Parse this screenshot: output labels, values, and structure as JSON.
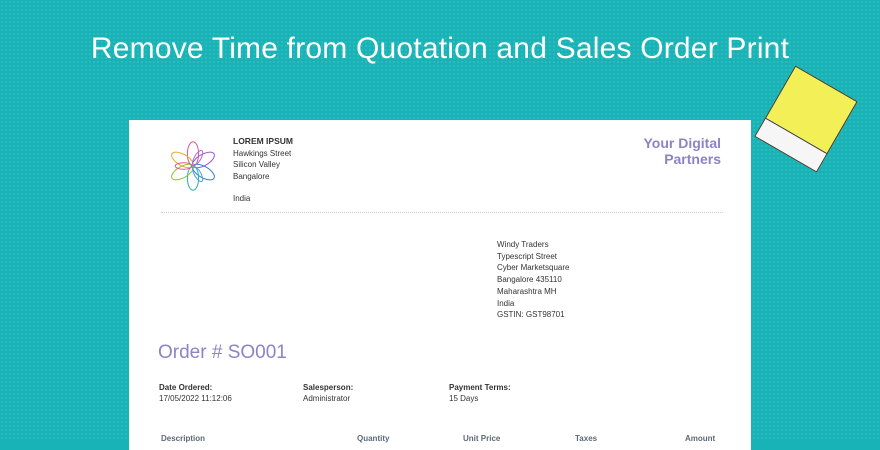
{
  "banner": {
    "title": "Remove Time from Quotation and Sales Order Print"
  },
  "company": {
    "name": "LOREM IPSUM",
    "address": [
      "Hawkings Street",
      "Silicon Valley",
      "Bangalore"
    ],
    "country": "India"
  },
  "tagline": [
    "Your Digital",
    "Partners"
  ],
  "customer": {
    "lines": [
      "Windy Traders",
      "Typescript Street",
      "Cyber Marketsquare",
      "Bangalore 435110",
      "Maharashtra MH",
      "India",
      "GSTIN: GST98701"
    ]
  },
  "order": {
    "title": "Order # SO001",
    "date_label": "Date Ordered:",
    "date_value": "17/05/2022 11:12:06",
    "salesperson_label": "Salesperson:",
    "salesperson_value": "Administrator",
    "terms_label": "Payment Terms:",
    "terms_value": "15 Days"
  },
  "table": {
    "headers": [
      "Description",
      "Quantity",
      "Unit Price",
      "Taxes",
      "Amount"
    ]
  },
  "icons": {
    "logo": "flower-logo-icon",
    "note": "sticky-note-icon"
  },
  "colors": {
    "background": "#17b3b6",
    "accent": "#8e83c4",
    "sticky": "#f2ef57"
  }
}
